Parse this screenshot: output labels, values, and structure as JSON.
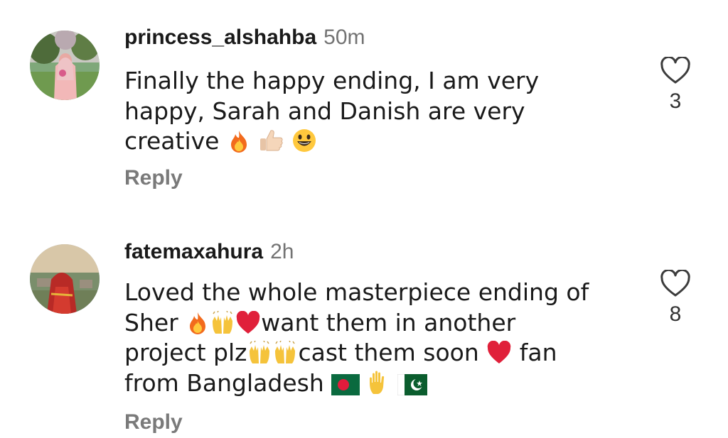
{
  "comments": [
    {
      "username": "princess_alshahba",
      "time": "50m",
      "text_lines": [
        "Finally the happy ending, I am very",
        "happy, Sarah and Danish are very",
        "creative"
      ],
      "trailing_emojis": [
        "fire-emoji",
        "thumbs-up-emoji",
        "smiling-face-emoji"
      ],
      "reply_label": "Reply",
      "like_count": "3",
      "heart_icon": "heart-outline-icon"
    },
    {
      "username": "fatemaxahura",
      "time": "2h",
      "text_parts": {
        "line1": "Loved the whole masterpiece ending of",
        "line2_a": "Sher",
        "line2_b": "want them in another",
        "line3_a": "project plz",
        "line3_b": "cast them soon",
        "line3_c": "fan",
        "line4": "from Bangladesh"
      },
      "emojis": [
        "fire-emoji",
        "raising-hands-emoji",
        "red-heart-emoji",
        "raising-hands-emoji",
        "raising-hands-emoji",
        "red-heart-emoji",
        "bangladesh-flag-emoji",
        "raised-hand-emoji",
        "pakistan-flag-emoji"
      ],
      "reply_label": "Reply",
      "like_count": "8",
      "heart_icon": "heart-outline-icon"
    }
  ]
}
